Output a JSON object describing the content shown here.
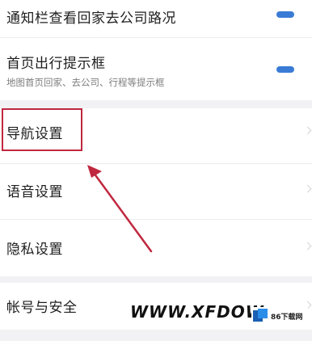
{
  "settings": {
    "notify_traffic": {
      "title": "通知栏查看回家去公司路况",
      "enabled": true
    },
    "home_travel_prompt": {
      "title": "首页出行提示框",
      "subtitle": "地图首页回家、去公司、行程等提示框",
      "enabled": true
    },
    "navigation": {
      "title": "导航设置"
    },
    "voice": {
      "title": "语音设置"
    },
    "privacy": {
      "title": "隐私设置"
    },
    "account": {
      "title": "帐号与安全"
    }
  },
  "annotation": {
    "box_color": "#c0283f",
    "arrow_color": "#c0283f"
  },
  "watermark": {
    "text": "WWW.XFDOW",
    "logo_label": "86下载网"
  },
  "colors": {
    "toggle_on": "#3a7bd5",
    "background": "#f2f2f4"
  }
}
